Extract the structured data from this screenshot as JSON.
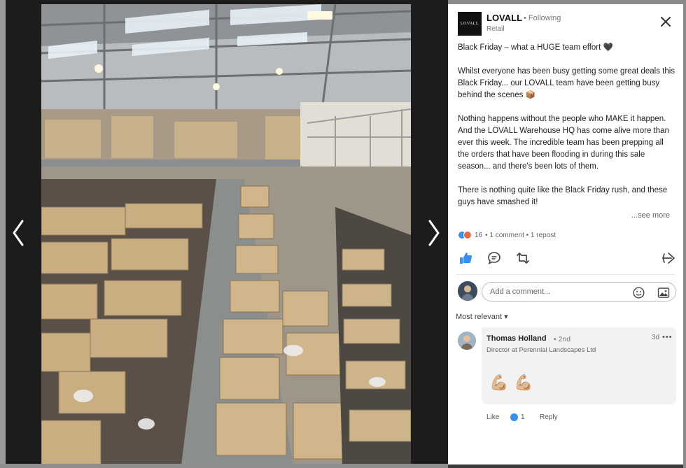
{
  "post": {
    "company": "LOVALL",
    "logo_text": "LOVALL",
    "following": "• Following",
    "industry": "Retail",
    "paragraphs": [
      "Black Friday – what a HUGE team effort 🖤",
      "Whilst everyone has been busy getting some great deals this Black Friday... our LOVALL team have been getting busy behind the scenes 📦",
      "Nothing happens without the people who MAKE it happen. And the LOVALL Warehouse HQ has come alive more than ever this week. The incredible team has been prepping all the orders that have been flooding in during this sale season... and there's been lots of them.",
      "There is nothing quite like the Black Friday rush, and these guys have smashed it!"
    ],
    "see_more": "...see more"
  },
  "social": {
    "reaction_count": "16",
    "counts_text": "• 1 comment • 1 repost"
  },
  "comment_box": {
    "placeholder": "Add a comment..."
  },
  "sort": {
    "label": "Most relevant ▾"
  },
  "comment": {
    "author": "Thomas Holland",
    "degree": "• 2nd",
    "headline": "Director at Perennial Landscapes Ltd",
    "time": "3d",
    "more": "•••",
    "body": "💪🏼💪🏼",
    "like_label": "Like",
    "like_count": "1",
    "reply_label": "Reply"
  },
  "icons": {
    "prev": "chevron-left-icon",
    "next": "chevron-right-icon",
    "close": "close-icon",
    "like": "thumbs-up-icon",
    "comment": "speech-bubble-icon",
    "repost": "repost-icon",
    "send": "send-icon",
    "emoji": "emoji-icon",
    "image": "image-icon"
  },
  "colors": {
    "accent": "#0a66c2",
    "like_blue": "#378fe9",
    "love_orange": "#df704d"
  }
}
